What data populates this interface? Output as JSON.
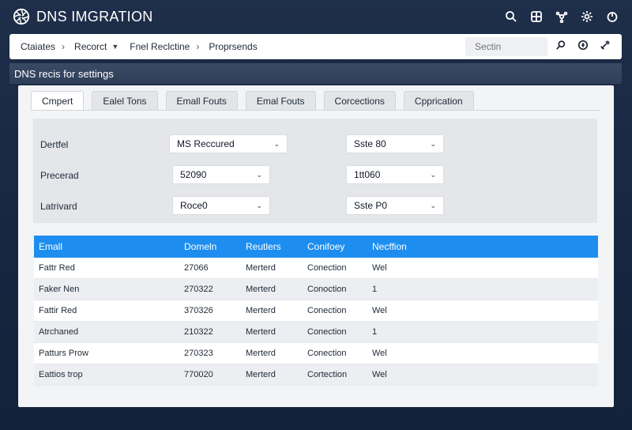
{
  "app": {
    "title": "DNS IMGRATION"
  },
  "appbar_icons": [
    "search-icon",
    "grid-icon",
    "network-icon",
    "settings-icon",
    "power-icon"
  ],
  "breadcrumb": {
    "items": [
      {
        "label": "Ctaiates",
        "suffix": "›"
      },
      {
        "label": "Recorct",
        "suffix": "⌄"
      },
      {
        "label": "Fnel Reclctine",
        "suffix": "›"
      },
      {
        "label": "Proprsends",
        "suffix": ""
      }
    ],
    "search_placeholder": "Sectin"
  },
  "section": {
    "title": "DNS recis for settings"
  },
  "tabs": [
    {
      "label": "Cmpert",
      "active": true
    },
    {
      "label": "Ealel Tons",
      "active": false
    },
    {
      "label": "Emall Fouts",
      "active": false
    },
    {
      "label": "Emal Fouts",
      "active": false
    },
    {
      "label": "Corcections",
      "active": false
    },
    {
      "label": "Cpprication",
      "active": false
    }
  ],
  "form": {
    "rows": [
      {
        "label": "Dertfel",
        "primary": "MS Reccured",
        "secondary": "Sste 80"
      },
      {
        "label": "Precerad",
        "primary": "52090",
        "secondary": "1tt060"
      },
      {
        "label": "Latrivard",
        "primary": "Roce0",
        "secondary": "Sste P0"
      }
    ]
  },
  "table": {
    "columns": [
      "Emall",
      "Domeln",
      "Reutlers",
      "Conifoey",
      "Necffion"
    ],
    "rows": [
      [
        "Fattr Red",
        "27066",
        "Merterd",
        "Conection",
        "Wel"
      ],
      [
        "Faker Nen",
        "270322",
        "Merterd",
        "Conoction",
        "1"
      ],
      [
        "Fattir Red",
        "370326",
        "Merterd",
        "Conection",
        "Wel"
      ],
      [
        "Atrchaned",
        "210322",
        "Merterd",
        "Conection",
        "1"
      ],
      [
        "Patturs Prow",
        "270323",
        "Merterd",
        "Conection",
        "Wel"
      ],
      [
        "Eattios trop",
        "770020",
        "Merterd",
        "Cortection",
        "Wel"
      ]
    ]
  },
  "colors": {
    "background": "#1e2f4a",
    "table_header": "#1d8ef0",
    "panel": "#f3f4f6"
  }
}
